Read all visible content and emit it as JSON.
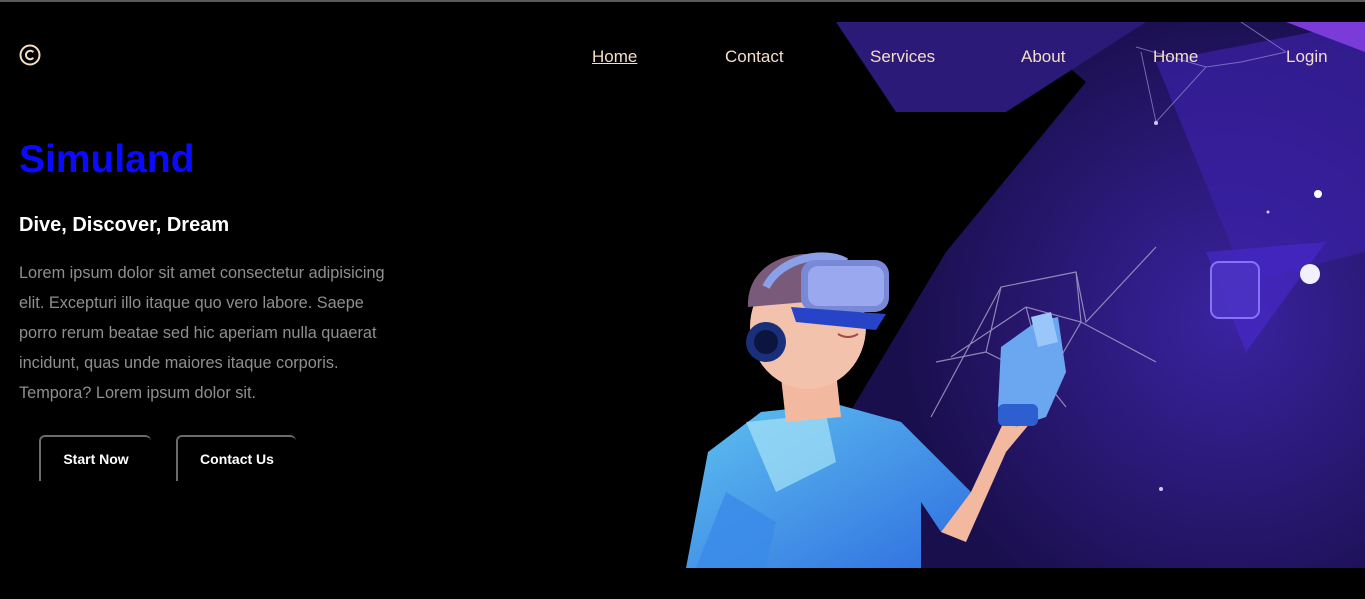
{
  "logo": {
    "icon": "copyright-icon",
    "color": "#f5ddc6"
  },
  "nav": {
    "items": [
      {
        "label": "Home",
        "active": true
      },
      {
        "label": "Contact"
      },
      {
        "label": "Services"
      },
      {
        "label": "About"
      },
      {
        "label": "Home"
      },
      {
        "label": "Login"
      }
    ]
  },
  "hero": {
    "title": "Simuland",
    "subtitle": "Dive, Discover, Dream",
    "description": "Lorem ipsum dolor sit amet consectetur adipisicing elit. Excepturi illo itaque quo vero labore. Saepe porro rerum beatae sed hic aperiam nulla quaerat incidunt, quas unde maiores itaque corporis. Tempora? Lorem ipsum dolor sit.",
    "buttons": {
      "start": "Start Now",
      "contact": "Contact Us"
    }
  },
  "colors": {
    "background": "#000000",
    "title": "#0a0aff",
    "nav_text": "#f5ddc6",
    "description": "#8f8f8f",
    "art_purple": "#2a1870"
  },
  "image": {
    "subject": "vr-headset-person-illustration"
  }
}
